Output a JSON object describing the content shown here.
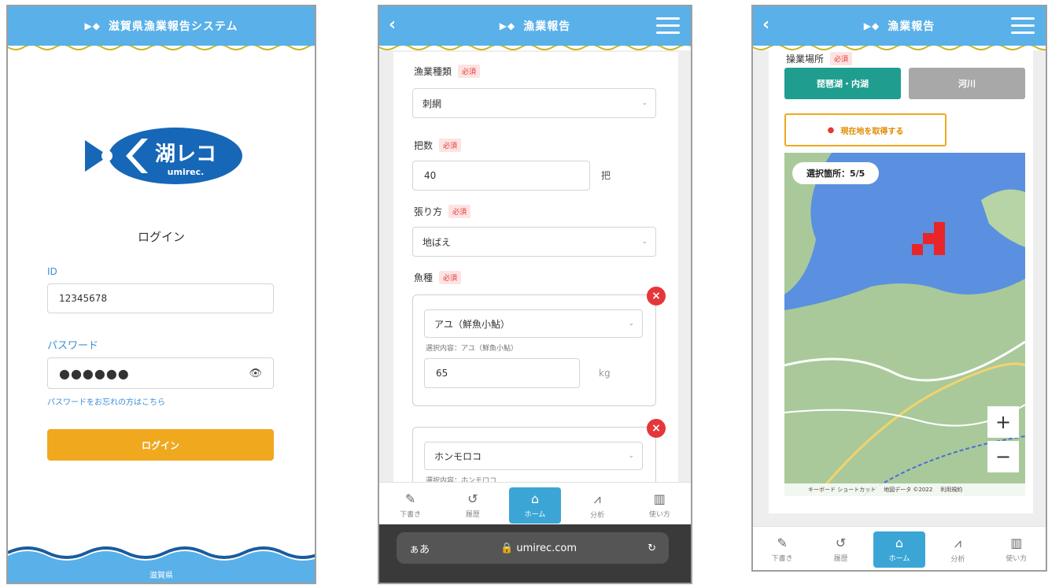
{
  "login": {
    "header_title": "滋賀県漁業報告システム",
    "logo_text": "湖レコ",
    "logo_sub": "umirec.",
    "title": "ログイン",
    "id_label": "ID",
    "id_value": "12345678",
    "password_label": "パスワード",
    "password_value": "●●●●●●",
    "forgot_link": "パスワードをお忘れの方はこちら",
    "login_button": "ログイン",
    "footer": "滋賀県"
  },
  "report": {
    "header_title": "漁業報告",
    "required": "必須",
    "fishing_type_label": "漁業種類",
    "fishing_type_value": "刺網",
    "count_label": "把数",
    "count_value": "40",
    "count_unit": "把",
    "method_label": "張り方",
    "method_value": "地ばえ",
    "species_label": "魚種",
    "species": [
      {
        "name": "アユ（鮮魚小鮎）",
        "selected": "選択内容：アユ（鮮魚小鮎）",
        "weight": "65",
        "unit": "kg"
      },
      {
        "name": "ホンモロコ",
        "selected": "選択内容：ホンモロコ"
      }
    ],
    "browser_aa": "ぁあ",
    "browser_url": "umirec.com"
  },
  "map_page": {
    "header_title": "漁業報告",
    "area_label": "操業場所",
    "required": "必須",
    "seg_lake": "琵琶湖・内湖",
    "seg_river": "河川",
    "loc_button": "現在地を取得する",
    "selected_pill": "選択箇所：5/5",
    "zoom_in": "+",
    "zoom_out": "−",
    "attrib1": "キーボード ショートカット",
    "attrib2": "地図データ ©2022",
    "attrib3": "利用規約"
  },
  "tabs": [
    {
      "label": "下書き",
      "icon": "pencil-icon",
      "glyph": "✎"
    },
    {
      "label": "履歴",
      "icon": "history-icon",
      "glyph": "↺"
    },
    {
      "label": "ホーム",
      "icon": "home-icon",
      "glyph": "⌂"
    },
    {
      "label": "分析",
      "icon": "chart-icon",
      "glyph": "📈"
    },
    {
      "label": "使い方",
      "icon": "book-icon",
      "glyph": "▥"
    }
  ],
  "colors": {
    "header": "#5ab0e8",
    "accent": "#f0a81f",
    "active_tab": "#3ba6d6",
    "lake": "#5b8fdf",
    "land": "#a9c99a",
    "selected_cell": "#e8262a"
  }
}
